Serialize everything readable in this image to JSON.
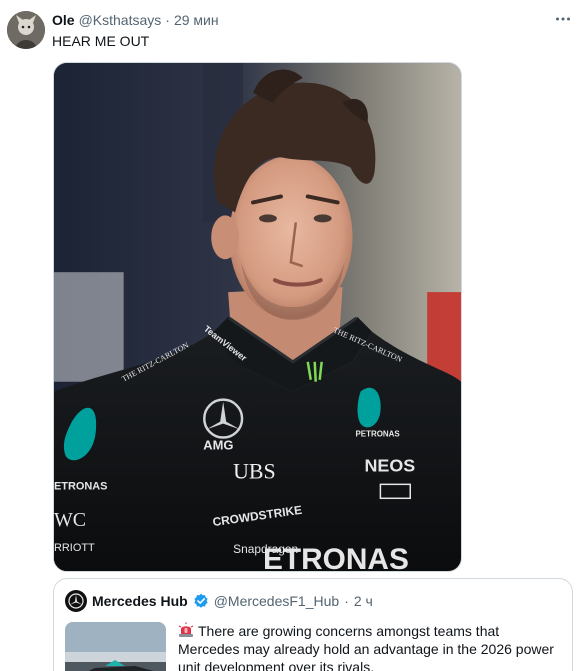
{
  "tweet": {
    "author": {
      "display_name": "Ole",
      "handle": "@Ksthatsays",
      "time": "29 мин",
      "avatar_icon": "avatar-image"
    },
    "more_icon": "more-horizontal-icon",
    "text": "HEAR ME OUT",
    "media": {
      "kind": "photo",
      "subject": "driver-in-racing-suit",
      "suit_texts": [
        "TeamViewer",
        "THE RITZ-CARLTON",
        "AMG",
        "UBS",
        "NEOS",
        "PETRONAS",
        "CROWDSTRIKE",
        "Snapdragon",
        "IWC",
        "Marriott"
      ]
    },
    "separator": "·"
  },
  "quoted_tweet": {
    "display_name": "Mercedes Hub",
    "handle": "@MercedesF1_Hub",
    "time": "2 ч",
    "verified": true,
    "separator": "·",
    "siren_icon": "siren-emoji-icon",
    "text": "There are growing concerns amongst teams that Mercedes may already hold an advantage in the 2026 power unit development over its rivals."
  },
  "colors": {
    "text_primary": "#0f1419",
    "text_secondary": "#536471",
    "border": "#cfd9de",
    "verified_blue": "#1d9bf0"
  }
}
